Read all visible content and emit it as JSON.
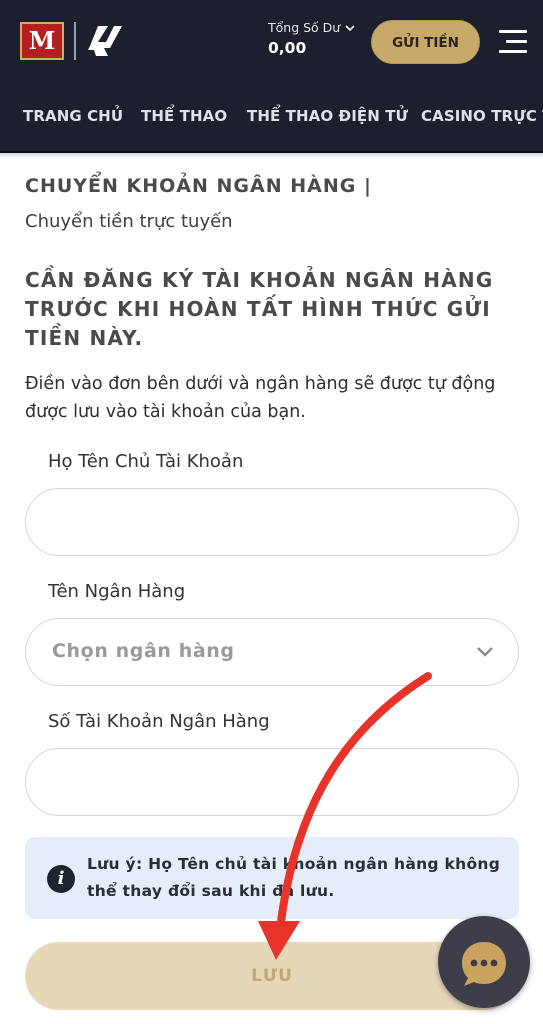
{
  "header": {
    "logo_letter": "M",
    "balance_label": "Tổng Số Dư",
    "balance_value": "0,00",
    "deposit_button": "GỬI TIỀN"
  },
  "nav": {
    "items": [
      {
        "label": "TRANG CHỦ"
      },
      {
        "label": "THỂ THAO"
      },
      {
        "label": "THỂ THAO ĐIỆN TỬ"
      },
      {
        "label": "CASINO TRỰC TUYẾN"
      }
    ]
  },
  "page": {
    "title": "CHUYỂN KHOẢN NGÂN HÀNG |",
    "subtitle": "Chuyển tiền trực tuyến",
    "warning": "CẦN ĐĂNG KÝ TÀI KHOẢN NGÂN HÀNG TRƯỚC KHI HOÀN TẤT HÌNH THỨC GỬI TIỀN NÀY.",
    "description": "Điền vào đơn bên dưới và ngân hàng sẽ được tự động được lưu vào tài khoản của bạn."
  },
  "form": {
    "account_name_label": "Họ Tên Chủ Tài Khoản",
    "account_name_value": "",
    "bank_name_label": "Tên Ngân Hàng",
    "bank_name_placeholder": "Chọn ngân hàng",
    "account_number_label": "Số Tài Khoản Ngân Hàng",
    "account_number_value": "",
    "note_text": "Lưu ý: Họ Tên chủ tài khoản ngân hàng không thể thay đổi sau khi đã lưu.",
    "save_button": "LƯU"
  },
  "icons": {
    "balance_toggle": "chevron-down-icon",
    "menu": "hamburger-menu-icon",
    "select": "chevron-down-icon",
    "note": "info-icon",
    "chat": "chat-bubble-icon"
  },
  "colors": {
    "header_bg": "#1c1f2c",
    "accent_gold": "#c9a96a",
    "save_disabled_bg": "#e6d7b9",
    "note_bg": "#e4edf8",
    "annotation_red": "#e8332a"
  }
}
